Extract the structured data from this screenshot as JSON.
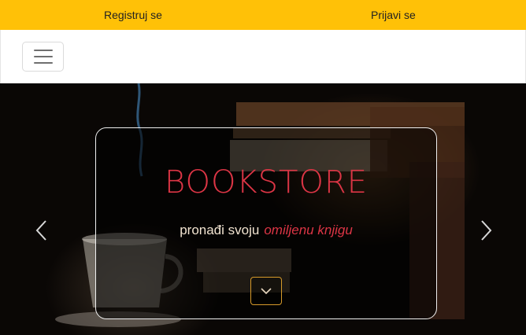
{
  "topbar": {
    "register_label": "Registruj se",
    "login_label": "Prijavi se"
  },
  "navbar": {
    "toggler_icon": "hamburger-menu-icon"
  },
  "hero": {
    "title": "BOOKSTORE",
    "tagline_plain": "pronađi svoju",
    "tagline_accent": "omiljenu knjigu",
    "prev_icon": "chevron-left-icon",
    "next_icon": "chevron-right-icon",
    "scroll_icon": "chevron-down-icon"
  },
  "colors": {
    "topbar_bg": "#ffc107",
    "brand_red": "#dc3545",
    "tagline_text": "#f1e3d0",
    "button_border": "#d69a2a"
  }
}
